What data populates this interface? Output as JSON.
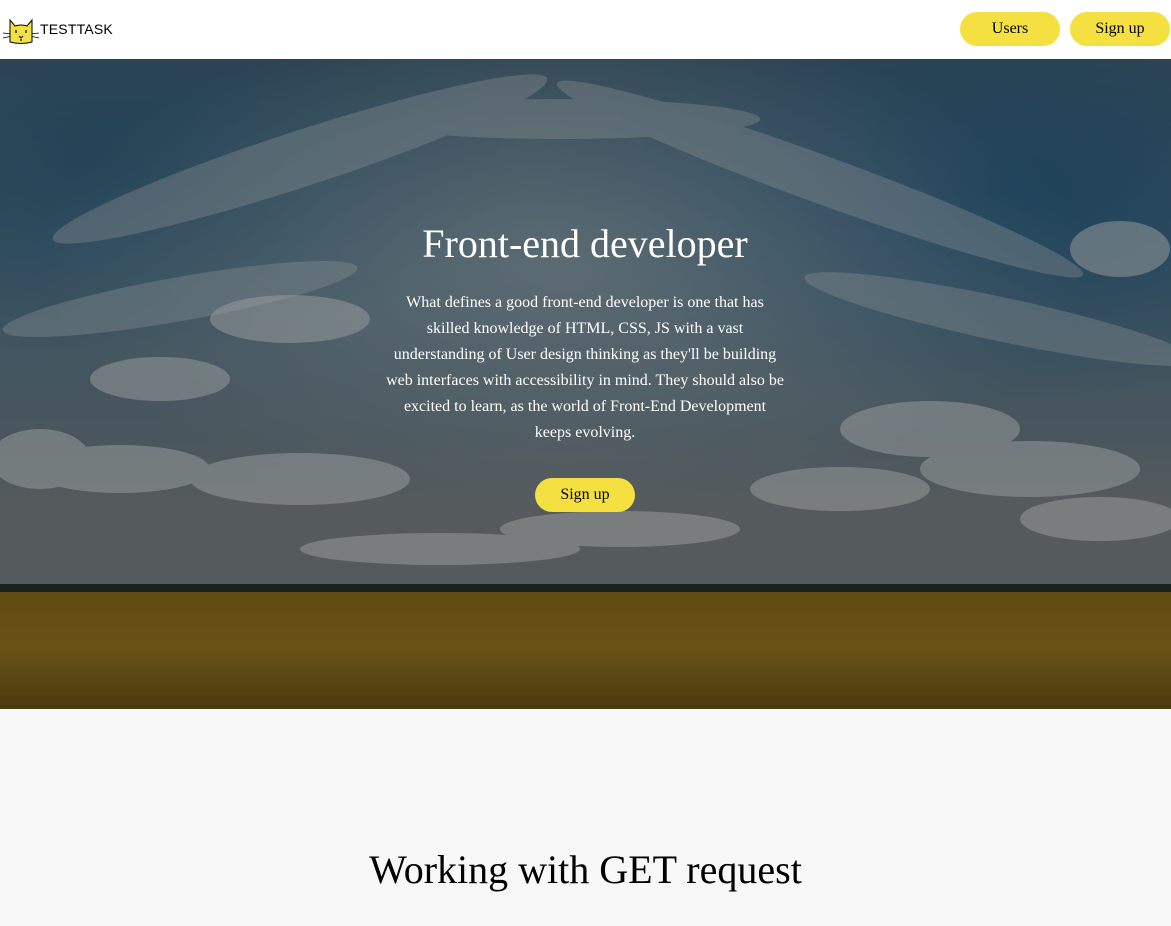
{
  "header": {
    "logo_text": "TESTTASK",
    "logo_icon": "cat-logo-icon",
    "nav": {
      "users_label": "Users",
      "signup_label": "Sign up"
    }
  },
  "hero": {
    "title": "Front-end developer",
    "text": "What defines a good front-end developer is one that has skilled knowledge of HTML, CSS, JS with a vast understanding of User design thinking as they'll be building web interfaces with accessibility in mind. They should also be excited to learn, as the world of Front-End Development keeps evolving.",
    "button_label": "Sign up"
  },
  "section": {
    "title": "Working with GET request"
  },
  "colors": {
    "accent": "#f4e041",
    "background": "#f8f8f8",
    "header": "#ffffff"
  }
}
